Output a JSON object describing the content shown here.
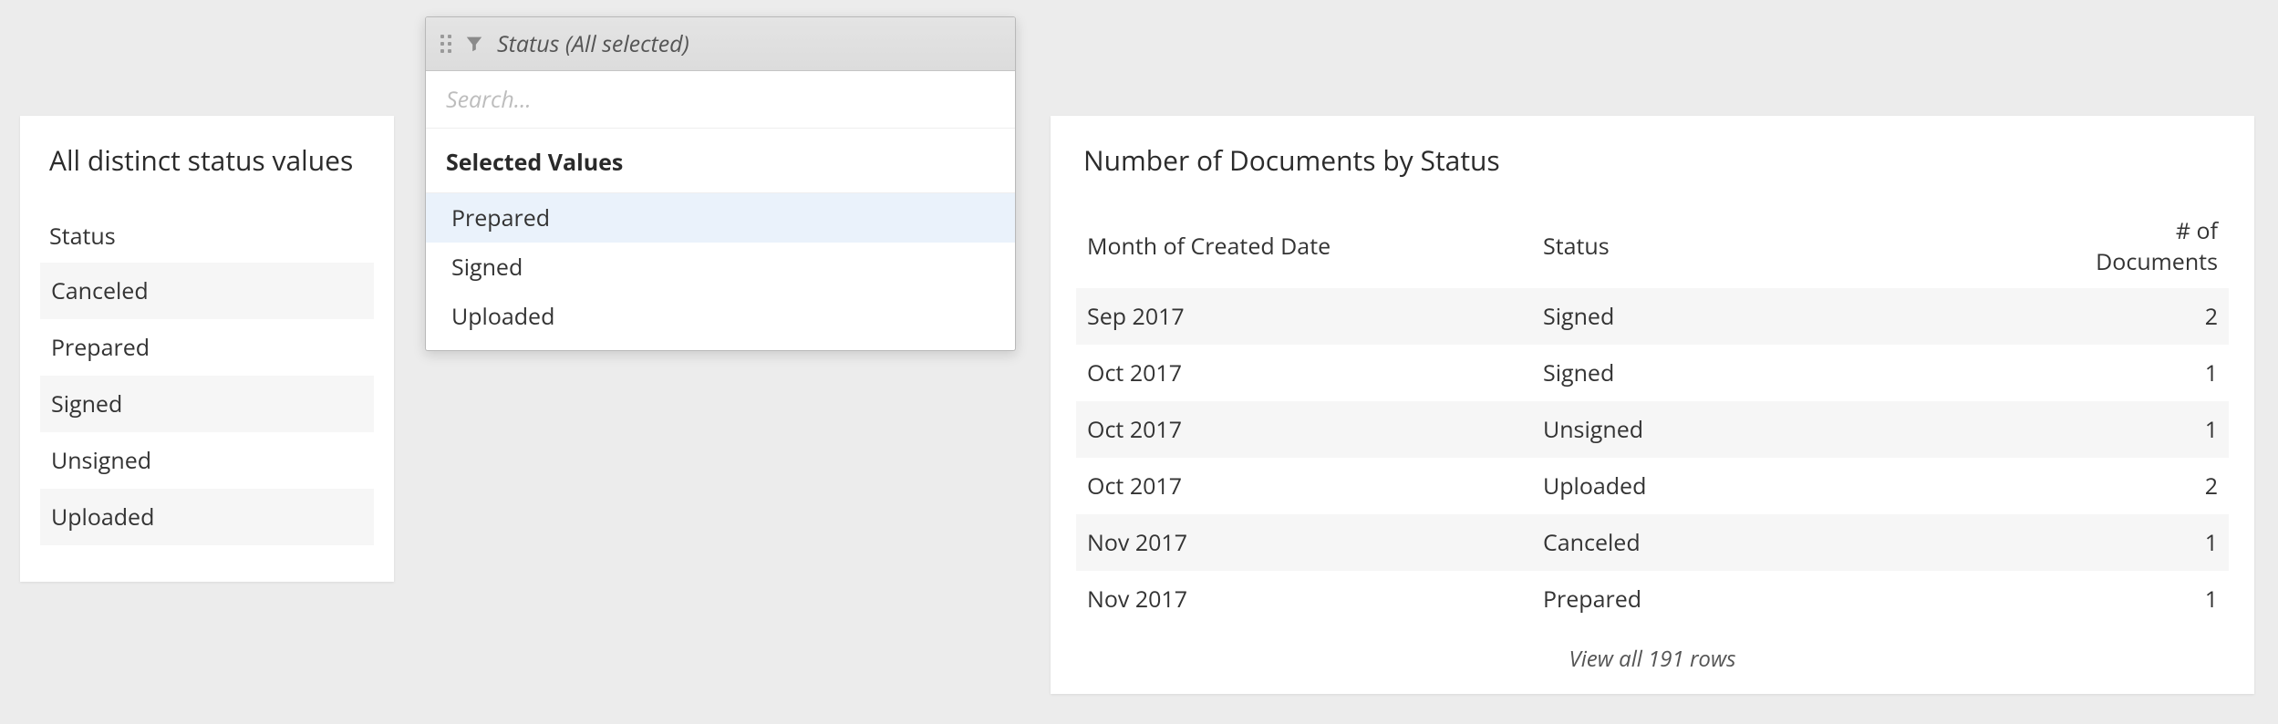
{
  "left_panel": {
    "title": "All distinct status values",
    "header": "Status",
    "items": [
      "Canceled",
      "Prepared",
      "Signed",
      "Unsigned",
      "Uploaded"
    ]
  },
  "filter": {
    "header_label": "Status (All selected)",
    "search_placeholder": "Search...",
    "section_title": "Selected Values",
    "options": [
      "Prepared",
      "Signed",
      "Uploaded"
    ],
    "highlighted_index": 0
  },
  "right_panel": {
    "title": "Number of Documents by Status",
    "columns": [
      "Month of Created Date",
      "Status",
      "# of Documents"
    ],
    "rows": [
      {
        "month": "Sep 2017",
        "status": "Signed",
        "count": 2
      },
      {
        "month": "Oct 2017",
        "status": "Signed",
        "count": 1
      },
      {
        "month": "Oct 2017",
        "status": "Unsigned",
        "count": 1
      },
      {
        "month": "Oct 2017",
        "status": "Uploaded",
        "count": 2
      },
      {
        "month": "Nov 2017",
        "status": "Canceled",
        "count": 1
      },
      {
        "month": "Nov 2017",
        "status": "Prepared",
        "count": 1
      }
    ],
    "view_all": "View all 191 rows"
  },
  "chart_data": {
    "type": "table",
    "columns": [
      "Month of Created Date",
      "Status",
      "# of Documents"
    ],
    "rows": [
      [
        "Sep 2017",
        "Signed",
        2
      ],
      [
        "Oct 2017",
        "Signed",
        1
      ],
      [
        "Oct 2017",
        "Unsigned",
        1
      ],
      [
        "Oct 2017",
        "Uploaded",
        2
      ],
      [
        "Nov 2017",
        "Canceled",
        1
      ],
      [
        "Nov 2017",
        "Prepared",
        1
      ]
    ],
    "total_rows": 191
  }
}
